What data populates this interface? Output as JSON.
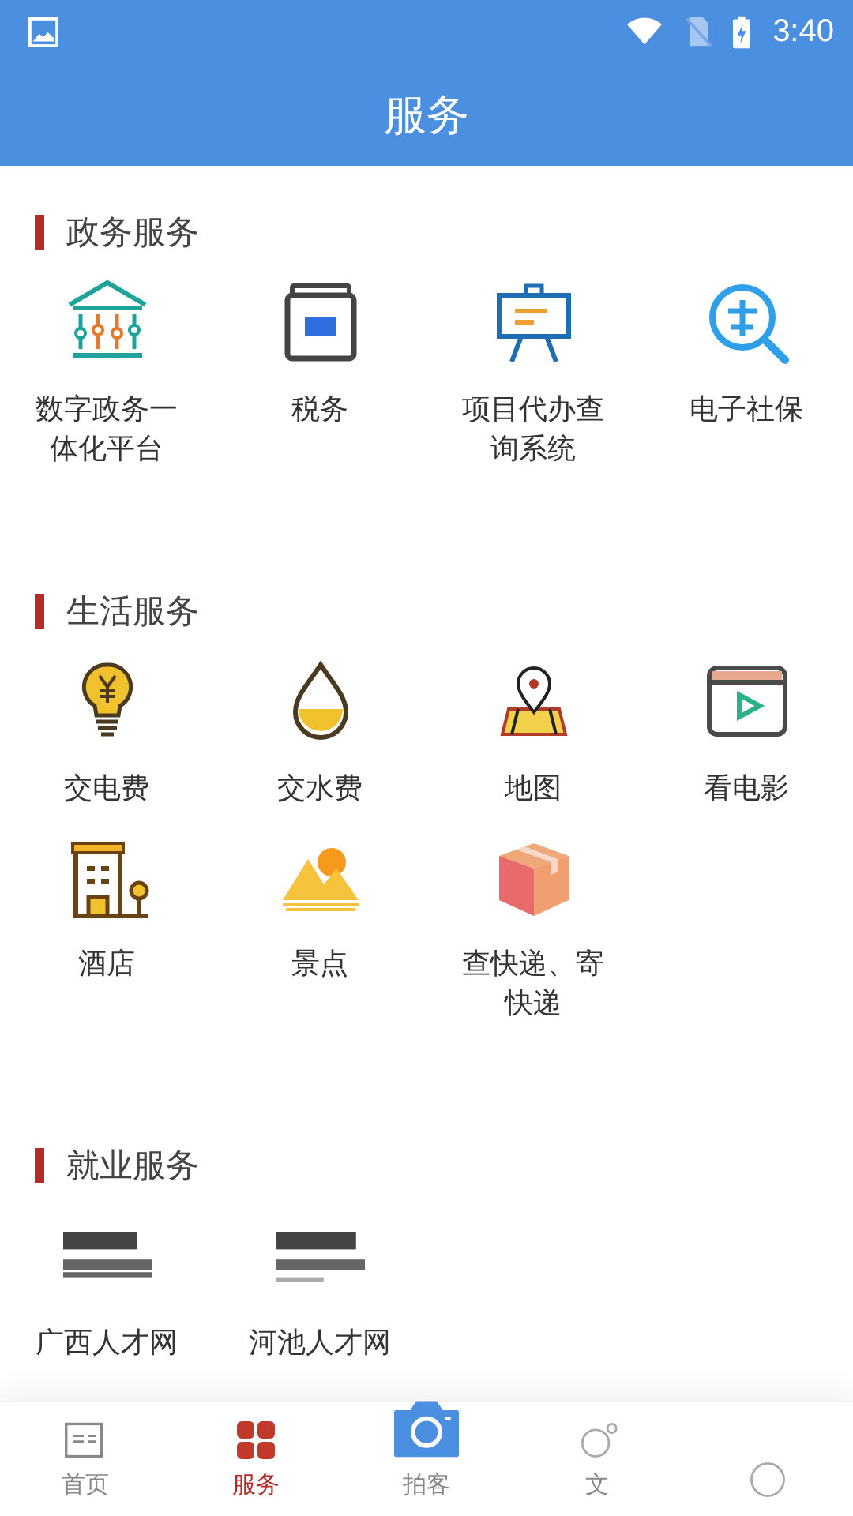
{
  "status_bar": {
    "time": "3:40"
  },
  "title": "服务",
  "sections": [
    {
      "title": "政务服务",
      "items": [
        {
          "label": "数字政务一体化平台",
          "kind": "icon"
        },
        {
          "label": "税务",
          "kind": "icon"
        },
        {
          "label": "项目代办查询系统",
          "kind": "icon"
        },
        {
          "label": "电子社保",
          "kind": "icon"
        }
      ]
    },
    {
      "title": "生活服务",
      "items": [
        {
          "label": "交电费",
          "kind": "icon"
        },
        {
          "label": "交水费",
          "kind": "icon"
        },
        {
          "label": "地图",
          "kind": "icon"
        },
        {
          "label": "看电影",
          "kind": "icon"
        },
        {
          "label": "酒店",
          "kind": "icon"
        },
        {
          "label": "景点",
          "kind": "icon"
        },
        {
          "label": "查快递、寄快递",
          "kind": "icon"
        }
      ]
    },
    {
      "title": "就业服务",
      "items": [
        {
          "label": "广西人才网",
          "kind": "picture"
        },
        {
          "label": "河池人才网",
          "kind": "picture"
        }
      ]
    }
  ],
  "tabs": [
    {
      "label": "首页",
      "kind": "tab",
      "selected": false
    },
    {
      "label": "服务",
      "kind": "tab",
      "selected": true
    },
    {
      "label": "拍客",
      "kind": "camera",
      "selected": false
    },
    {
      "label": "文",
      "kind": "tab",
      "selected": false
    },
    {
      "kind": "tab",
      "selected": false
    }
  ]
}
